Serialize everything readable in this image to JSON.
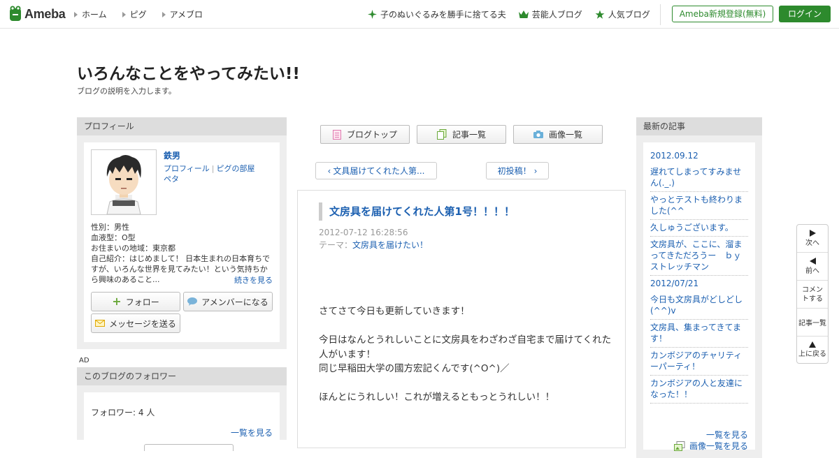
{
  "header": {
    "logo_text": "Ameba",
    "nav": [
      "ホーム",
      "ピグ",
      "アメブロ"
    ],
    "trending": [
      {
        "icon": "sparkle-icon",
        "label": "子のぬいぐるみを勝手に捨てる夫"
      },
      {
        "icon": "crown-icon",
        "label": "芸能人ブログ"
      },
      {
        "icon": "star-icon",
        "label": "人気ブログ"
      }
    ],
    "register_label": "Ameba新規登録(無料)",
    "login_label": "ログイン",
    "accent": "#2d8a2d"
  },
  "blog": {
    "title": "いろんなことをやってみたい!!",
    "description": "ブログの説明を入力します。"
  },
  "profile": {
    "heading": "プロフィール",
    "name": "鉄男",
    "link_profile": "プロフィール",
    "link_pig": "ピグの部屋",
    "link_peta": "ペタ",
    "gender": "性別：男性",
    "blood": "血液型：O型",
    "area": "お住まいの地域：東京都",
    "intro": "自己紹介：はじめまして！ 日本生まれの日本育ちですが、いろんな世界を見てみたい！という気持ちから興味のあること...",
    "more": "続きを見る",
    "follow_label": "フォロー",
    "amember_label": "アメンバーになる",
    "message_label": "メッセージを送る"
  },
  "ad_label": "AD",
  "followers": {
    "heading": "このブログのフォロワー",
    "count_label": "フォロワー: ",
    "count": "4",
    "unit": " 人",
    "more": "一覧を見る"
  },
  "center_nav": {
    "blog_top": "ブログトップ",
    "article_list": "記事一覧",
    "image_list": "画像一覧",
    "prev_label": "文具届けてくれた人第...",
    "first_post_label": "初投稿！"
  },
  "article": {
    "title": "文房具を届けてくれた人第1号！！！！",
    "date": "2012-07-12 16:28:56",
    "theme_label": "テーマ：",
    "theme": "文房具を届けたい！",
    "body": [
      "さてさて今日も更新していきます！",
      "",
      "今日はなんとうれしいことに文房具をわざわざ自宅まで届けてくれた人がいます！",
      "同じ早稲田大学の國方宏記くんです(^O^)／",
      "",
      "ほんとにうれしい！これが増えるともっとうれしい！！"
    ]
  },
  "recent": {
    "heading": "最新の記事",
    "items": [
      "2012.09.12",
      "遅れてしまってすみません(._.)",
      "やっとテストも終わりました(^^",
      "久しゅうございます。",
      "文房具が、ここに、溜まってきただろうー　ｂｙストレッチマン",
      "2012/07/21",
      "今日も文房具がどしどし(^^)v",
      "文房具、集まってきてます！",
      "カンボジアのチャリティーパーティ！",
      "カンボジアの人と友達になった！！"
    ],
    "more": "一覧を見る",
    "image_more": "画像一覧を見る"
  },
  "side_nav": {
    "next": "次へ",
    "prev": "前へ",
    "comment": "コメントする",
    "list": "記事一覧",
    "top": "上に戻る"
  }
}
